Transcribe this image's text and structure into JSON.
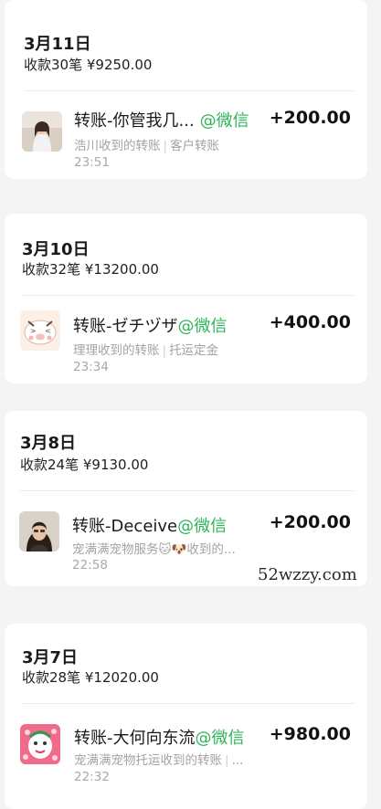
{
  "watermark": "52wzzy.com",
  "groups": [
    {
      "date": "3月11日",
      "summary": "收款30笔 ¥9250.00",
      "item": {
        "title": "转账-你管我几...",
        "source": "@微信",
        "amount": "+200.00",
        "receiver": "浩川收到的转账",
        "category": "客户转账",
        "time": "23:51",
        "avatar": "photo-girl-avatar"
      }
    },
    {
      "date": "3月10日",
      "summary": "收款32笔 ¥13200.00",
      "item": {
        "title": "转账-ゼチヅザ",
        "source": "@微信",
        "amount": "+400.00",
        "receiver": "理理收到的转账",
        "category": "托运定金",
        "time": "23:34",
        "avatar": "cartoon-pig-avatar"
      }
    },
    {
      "date": "3月8日",
      "summary": "收款24笔 ¥9130.00",
      "item": {
        "title": "转账-Deceive",
        "source": "@微信",
        "amount": "+200.00",
        "receiver": "宠满满宠物服务🐱🐶收到的...",
        "category": "",
        "time": "22:58",
        "avatar": "dark-hair-portrait-avatar"
      }
    },
    {
      "date": "3月7日",
      "summary": "收款28笔 ¥12020.00",
      "item": {
        "title": "转账-大何向东流",
        "source": "@微信",
        "amount": "+980.00",
        "receiver": "宠满满宠物托运收到的转账",
        "category": "...",
        "time": "22:32",
        "avatar": "pink-cartoon-avatar"
      }
    }
  ]
}
